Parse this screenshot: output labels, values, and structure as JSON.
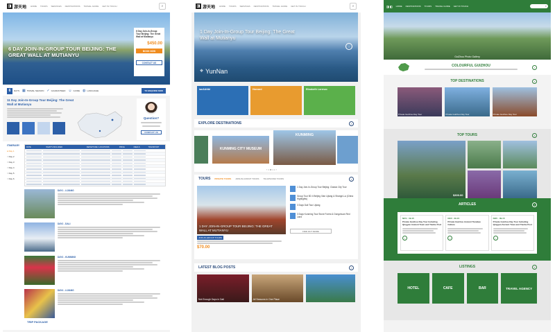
{
  "brand": {
    "logo_text": "游天地",
    "accent": "#2c5fa8",
    "orange": "#f08c1e",
    "green": "#2f7d3a"
  },
  "nav": {
    "items": [
      "HOME",
      "TOURS",
      "SERVICES",
      "DESTINATIONS",
      "TRAVEL GUIDE",
      "GET IN TOUCH"
    ]
  },
  "p1": {
    "hero_title": "6 DAY JOIN-IN-GROUP TOUR BEIJING: THE GREAT WALL AT MUTIANYU",
    "booking": {
      "title": "6 Day Join-In-Group Tour Beijing: The Great Wall at Mutianyu",
      "price": "$450.00",
      "book_label": "BOOK NOW",
      "contact_label": "CONTACT US"
    },
    "stats": [
      {
        "num": "6",
        "label": "DAYS"
      },
      {
        "num": "",
        "label": "TRAVEL SEASON"
      },
      {
        "num": "",
        "label": "GUARANTEED"
      },
      {
        "num": "",
        "label": "GUIDE"
      },
      {
        "num": "",
        "label": "LANGUAGE"
      }
    ],
    "enquire_label": "TO ENQUIRE NOW",
    "trip_title": "11 Day Join-In-Group Tour Beijing: The Great Wall at Mutianyu",
    "question_label": "Question?",
    "contact_label": "CONTACT US",
    "itinerary_label": "ITINERARY",
    "days": [
      "Day 1",
      "Day 2",
      "Day 3",
      "Day 4",
      "Day 5",
      "Day 6"
    ],
    "table_headers": [
      "DATE",
      "WHAT'S INCLUDED",
      "DEPARTURE / LOCATIONS",
      "PRICE",
      "MEALS",
      "TRANSPORT"
    ],
    "day_entries": [
      "DAY1 - LIJIANG",
      "DAY2 - DALI",
      "DAY3 - KUNMING",
      "DAY4 - LIJIANG"
    ],
    "footer": "TRIP PACKAGE"
  },
  "p2": {
    "hero_title": "1 Day Join-In-Group Tour Beijing: The Great Wall at Mutianyu",
    "hero_location": "YunNan",
    "promos": [
      "ian&Attbl",
      "Harvard",
      "Elizabeth Lorenzo"
    ],
    "explore_title": "EXPLORE DESTINATIONS",
    "dest": [
      "KUNMING CITY MUSEUM",
      "KUNMING"
    ],
    "tours_title": "TOURS",
    "tour_tabs": [
      "PRIVATE TOURS",
      "JOIN-IN-GROUP TOURS",
      "TELEPHONE TOURS"
    ],
    "tour_feature": "1 DAY JOIN-IN-GROUP TOUR BEIJING: THE GREAT WALL AT MUTIANYU",
    "tour_tag": "JOIN-IN-GROUP TOURS",
    "tour_price": "$70.00",
    "tour_list": [
      "1 Day Join-In-Group Tour Beijing: Classic City Tour",
      "Group Tour 5D 4 Beijing Xian Lijiang & Shangri-La (China Highlights)",
      "3 Days Dali Tour Lijiang",
      "3 Days Kunming Tour Stone Forest & Dongchuan Red Land"
    ],
    "find_label": "FIND OUT MORE",
    "blog_title": "LATEST BLOG POSTS",
    "blog_posts": [
      "Not Enough Days in Dali",
      "All Seasons in One Place",
      ""
    ]
  },
  "p3": {
    "hero_caption": "GuiZhou Photo Gallery",
    "colourful_title": "COLOURFUL GUIZHOU",
    "top_dest_title": "TOP DESTINATIONS",
    "dest_cards": [
      "Private Guizhou Day Tour",
      "Private Guizhou Day Tour",
      "Private Guizhou Day Tour"
    ],
    "top_tours_title": "TOP TOURS",
    "tour_prices": [
      "$300.00",
      "",
      "",
      ""
    ],
    "articles_title": "ARTICLES",
    "articles": [
      {
        "date": "NOV · 09·15",
        "title": "Private Guizhou Day Tour Including Qingyan Ancient Town and Tianhe Pool"
      },
      {
        "date": "NOV · 09·15",
        "title": "Private Guizhou Ancient Tunabao Culture"
      },
      {
        "date": "NOV · 09·15",
        "title": "Private Guizhou Day Tour Including Qingyan Ancient Town and Tianhe Pool"
      }
    ],
    "listings_title": "LISTINGS",
    "listings": [
      "HOTEL",
      "CAFE",
      "BAR",
      "TRAVEL AGENCY"
    ]
  }
}
